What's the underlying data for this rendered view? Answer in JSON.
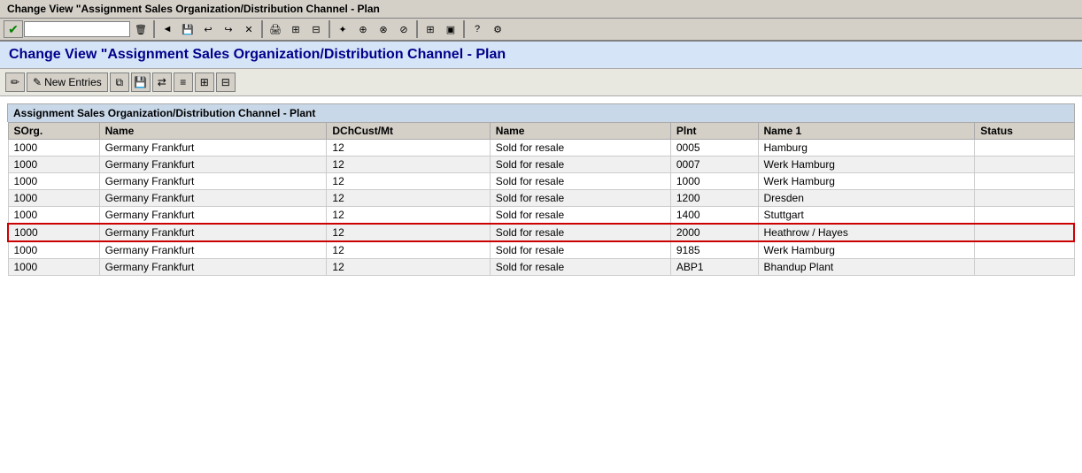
{
  "titleBar": {
    "text": "Change View \"Assignment Sales Organization/Distribution Channel - Plan"
  },
  "pageTitle": "Change View \"Assignment Sales Organization/Distribution Channel - Plan",
  "tableLabel": "Assignment Sales Organization/Distribution Channel - Plant",
  "toolbar": {
    "inputPlaceholder": ""
  },
  "actionBar": {
    "newEntriesLabel": "New Entries"
  },
  "columns": [
    {
      "key": "sorg",
      "label": "SOrg."
    },
    {
      "key": "name",
      "label": "Name"
    },
    {
      "key": "dchcust",
      "label": "DChCust/Mt"
    },
    {
      "key": "name2",
      "label": "Name"
    },
    {
      "key": "plnt",
      "label": "Plnt"
    },
    {
      "key": "name1",
      "label": "Name 1"
    },
    {
      "key": "status",
      "label": "Status"
    }
  ],
  "rows": [
    {
      "sorg": "1000",
      "name": "Germany Frankfurt",
      "dchcust": "12",
      "name2": "Sold for resale",
      "plnt": "0005",
      "name1": "Hamburg",
      "status": "",
      "highlighted": false
    },
    {
      "sorg": "1000",
      "name": "Germany Frankfurt",
      "dchcust": "12",
      "name2": "Sold for resale",
      "plnt": "0007",
      "name1": "Werk Hamburg",
      "status": "",
      "highlighted": false
    },
    {
      "sorg": "1000",
      "name": "Germany Frankfurt",
      "dchcust": "12",
      "name2": "Sold for resale",
      "plnt": "1000",
      "name1": "Werk Hamburg",
      "status": "",
      "highlighted": false
    },
    {
      "sorg": "1000",
      "name": "Germany Frankfurt",
      "dchcust": "12",
      "name2": "Sold for resale",
      "plnt": "1200",
      "name1": "Dresden",
      "status": "",
      "highlighted": false
    },
    {
      "sorg": "1000",
      "name": "Germany Frankfurt",
      "dchcust": "12",
      "name2": "Sold for resale",
      "plnt": "1400",
      "name1": "Stuttgart",
      "status": "",
      "highlighted": false
    },
    {
      "sorg": "1000",
      "name": "Germany Frankfurt",
      "dchcust": "12",
      "name2": "Sold for resale",
      "plnt": "2000",
      "name1": "Heathrow / Hayes",
      "status": "",
      "highlighted": true
    },
    {
      "sorg": "1000",
      "name": "Germany Frankfurt",
      "dchcust": "12",
      "name2": "Sold for resale",
      "plnt": "9185",
      "name1": "Werk Hamburg",
      "status": "",
      "highlighted": false
    },
    {
      "sorg": "1000",
      "name": "Germany Frankfurt",
      "dchcust": "12",
      "name2": "Sold for resale",
      "plnt": "ABP1",
      "name1": "Bhandup Plant",
      "status": "",
      "highlighted": false
    }
  ]
}
